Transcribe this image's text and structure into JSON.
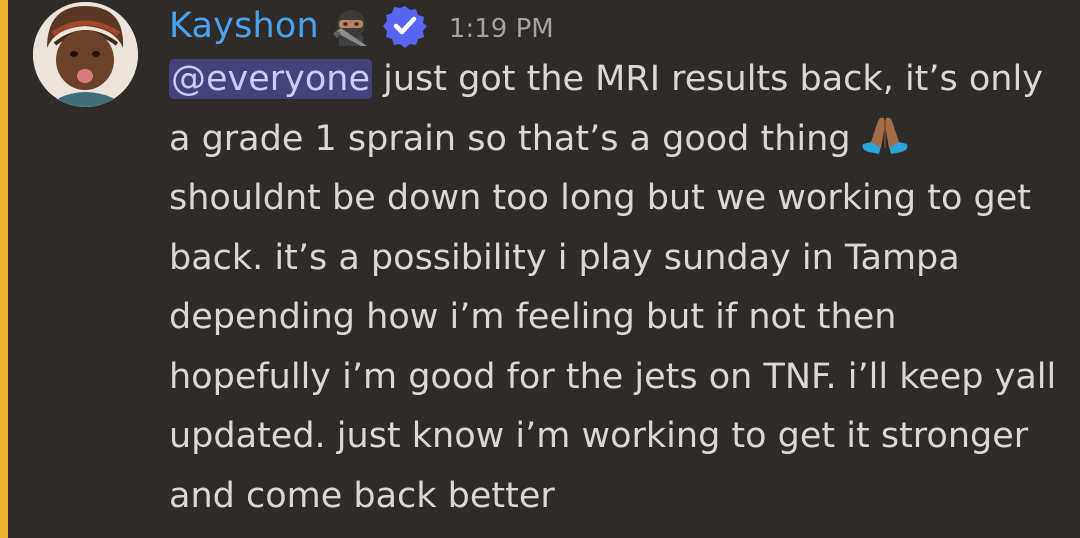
{
  "message": {
    "author": "Kayshon",
    "timestamp": "1:19 PM",
    "mention": "@everyone",
    "text_before_emoji": " just got the MRI results back, it’s only a grade 1 sprain so that’s a good thing",
    "text_after_emoji": " shouldnt be down too long but we working to get back. it’s a possibility i play sunday in Tampa depending how i’m feeling but if not then hopefully i’m good for the jets on TNF. i’ll keep yall updated. just know i’m working to get it stronger and come back better",
    "emoji": "folded-hands",
    "author_badges": [
      "ninja-emoji",
      "verified-badge"
    ]
  },
  "colors": {
    "background": "#2f2b28",
    "highlight_bar": "#f0b232",
    "username": "#4aa3f0",
    "mention_bg": "#44427a",
    "mention_text": "#c9cdfb",
    "text": "#dcd7d3",
    "timestamp": "#a7a2a0",
    "verified": "#5865f2"
  }
}
